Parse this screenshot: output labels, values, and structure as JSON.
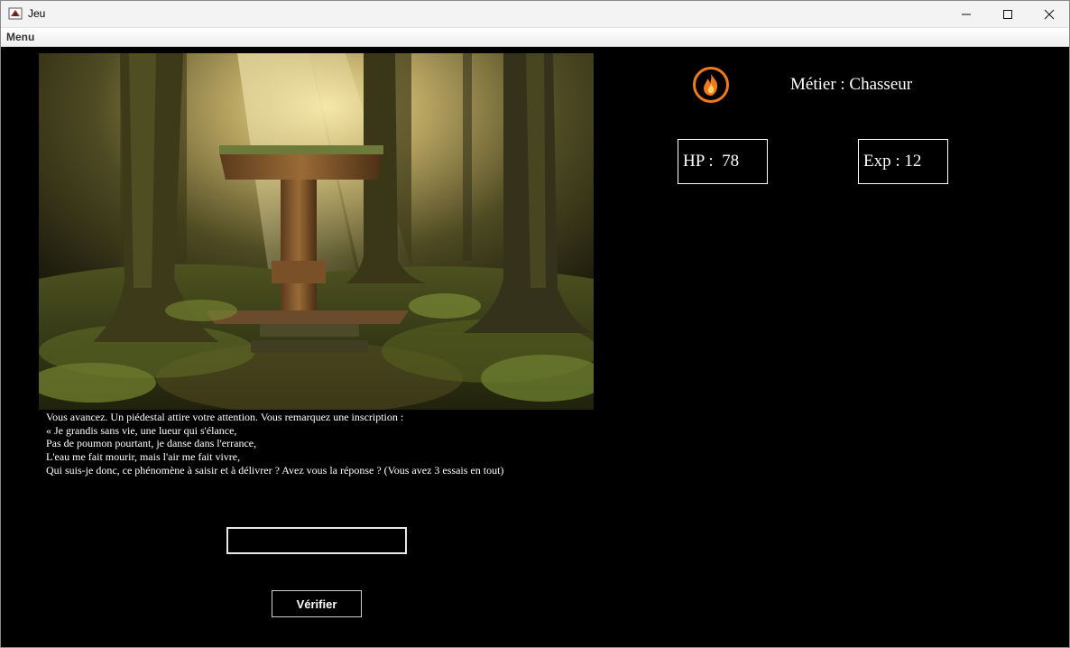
{
  "window": {
    "title": "Jeu",
    "menu_label": "Menu"
  },
  "story": {
    "lines": [
      "Vous avancez. Un piédestal attire votre attention. Vous remarquez une inscription :",
      "« Je grandis sans vie, une lueur qui s'élance,",
      "Pas de poumon pourtant, je danse dans l'errance,",
      "L'eau me fait mourir, mais l'air me fait vivre,",
      "Qui suis-je donc, ce phénomène à saisir et à délivrer ? Avez vous la réponse ? (Vous avez 3 essais en tout)"
    ]
  },
  "answer": {
    "value": "",
    "button_label": "Vérifier"
  },
  "player": {
    "job_text": "Métier : Chasseur",
    "hp_text": "HP :  78",
    "exp_text": "Exp : 12",
    "job_icon": "fire-icon"
  },
  "colors": {
    "background": "#000000",
    "fire_orange": "#f07a1c"
  }
}
